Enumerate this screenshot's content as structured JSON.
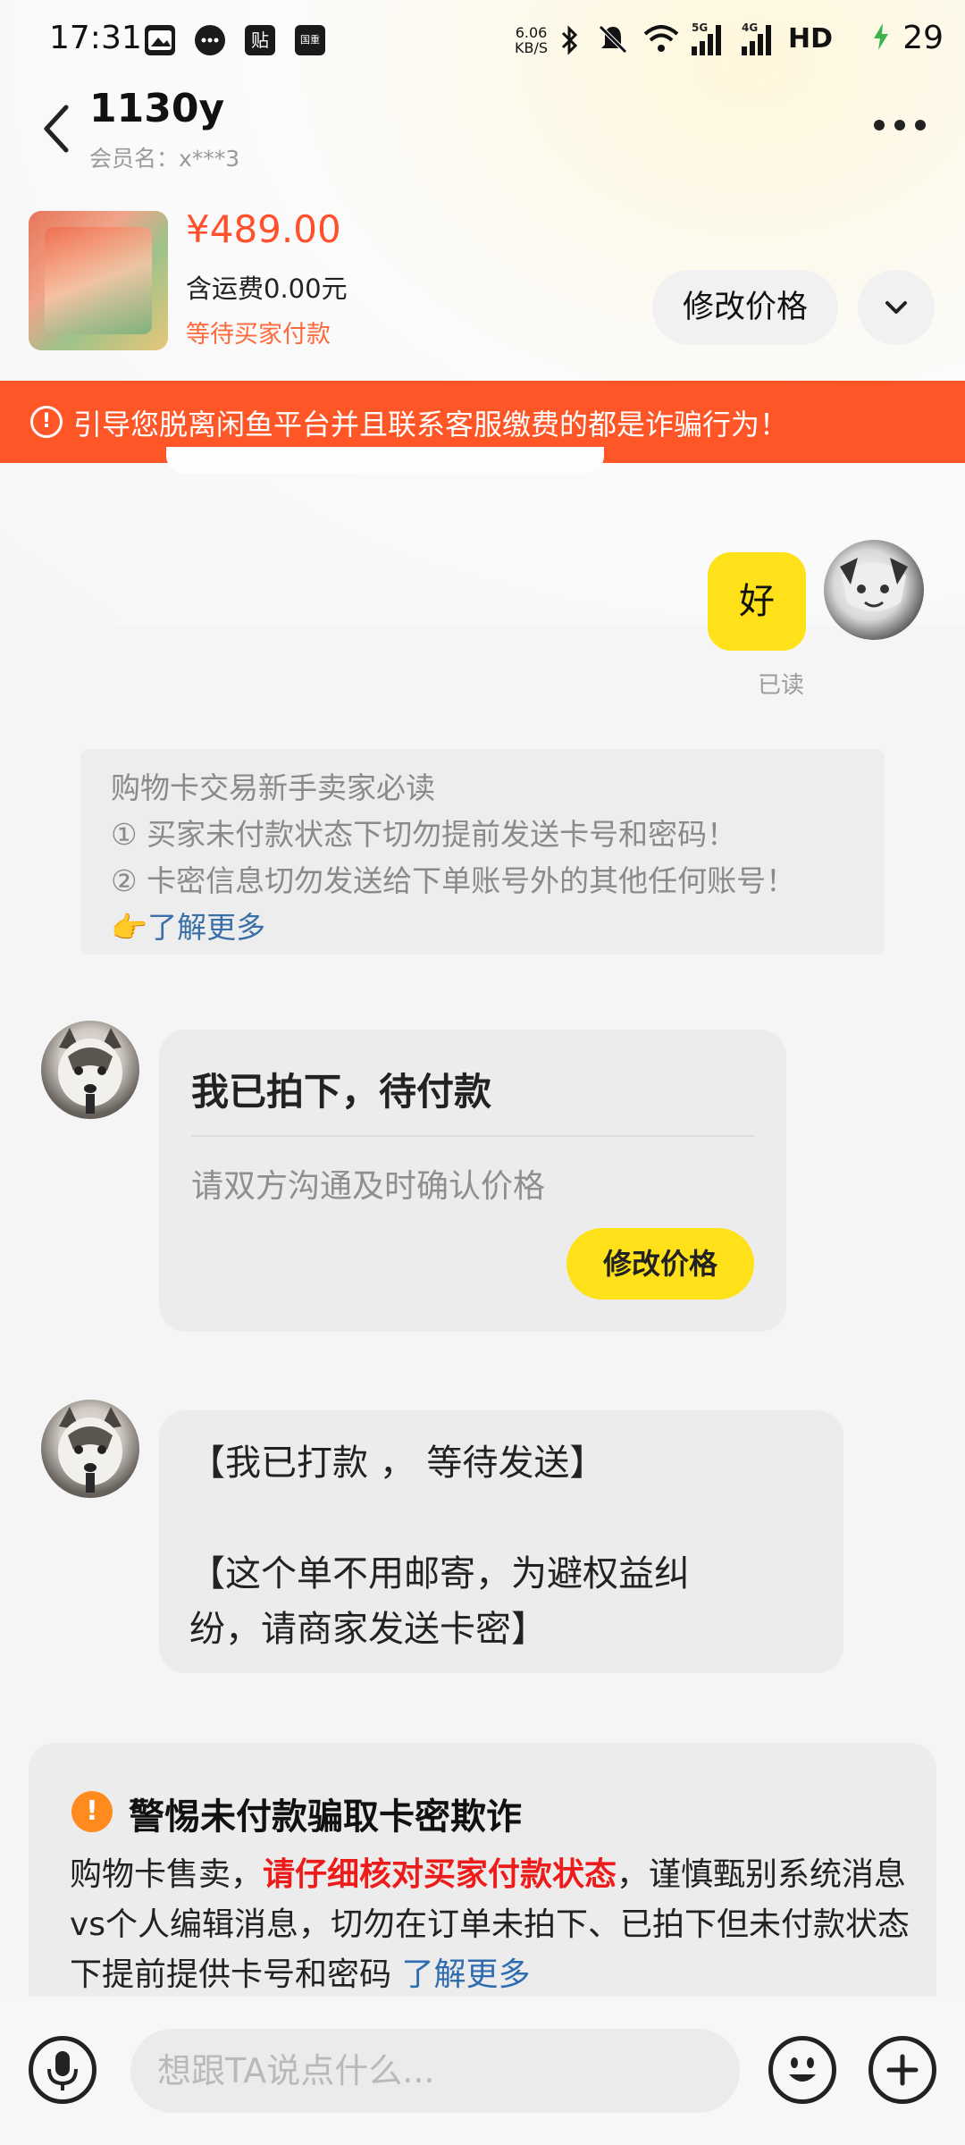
{
  "status_bar": {
    "time": "17:31",
    "notif_icon_labels": [
      "贴",
      "国重"
    ],
    "net_speed_value": "6.06",
    "net_speed_unit": "KB/S",
    "network_labels": [
      "5G",
      "4G",
      "HD"
    ],
    "battery": "29"
  },
  "header": {
    "title": "1130y",
    "member_name": "会员名：x***3"
  },
  "product": {
    "price": "¥489.00",
    "shipping": "含运费0.00元",
    "status": "等待买家付款",
    "modify_price_label": "修改价格"
  },
  "warning_banner": {
    "text": "引导您脱离闲鱼平台并且联系客服缴费的都是诈骗行为！"
  },
  "messages": {
    "my_message": "好",
    "read_status": "已读",
    "notice": {
      "title": "购物卡交易新手卖家必读",
      "line1": "① 买家未付款状态下切勿提前发送卡号和密码！",
      "line2": "② 卡密信息切勿发送给下单账号外的其他任何账号！",
      "more_emoji": "👉",
      "more": "了解更多"
    },
    "order_card": {
      "title": "我已拍下，待付款",
      "desc": "请双方沟通及时确认价格",
      "button": "修改价格"
    },
    "buyer_text": {
      "line1": "【我已打款 ， 等待发送】",
      "line2": "【这个单不用邮寄，为避权益纠",
      "line3": "纷，请商家发送卡密】"
    }
  },
  "scam_warning": {
    "title": "警惕未付款骗取卡密欺诈",
    "body_prefix": "购物卡售卖，",
    "body_highlight": "请仔细核对买家付款状态",
    "body_suffix": "，谨慎甄别系统消息vs个人编辑消息，切勿在订单未拍下、已拍下但未付款状态下提前提供卡号和密码 ",
    "more": "了解更多"
  },
  "input_bar": {
    "placeholder": "想跟TA说点什么..."
  },
  "colors": {
    "accent_yellow": "#ffe11a",
    "warning_orange": "#ff5627",
    "price_red": "#ff4f2b"
  }
}
